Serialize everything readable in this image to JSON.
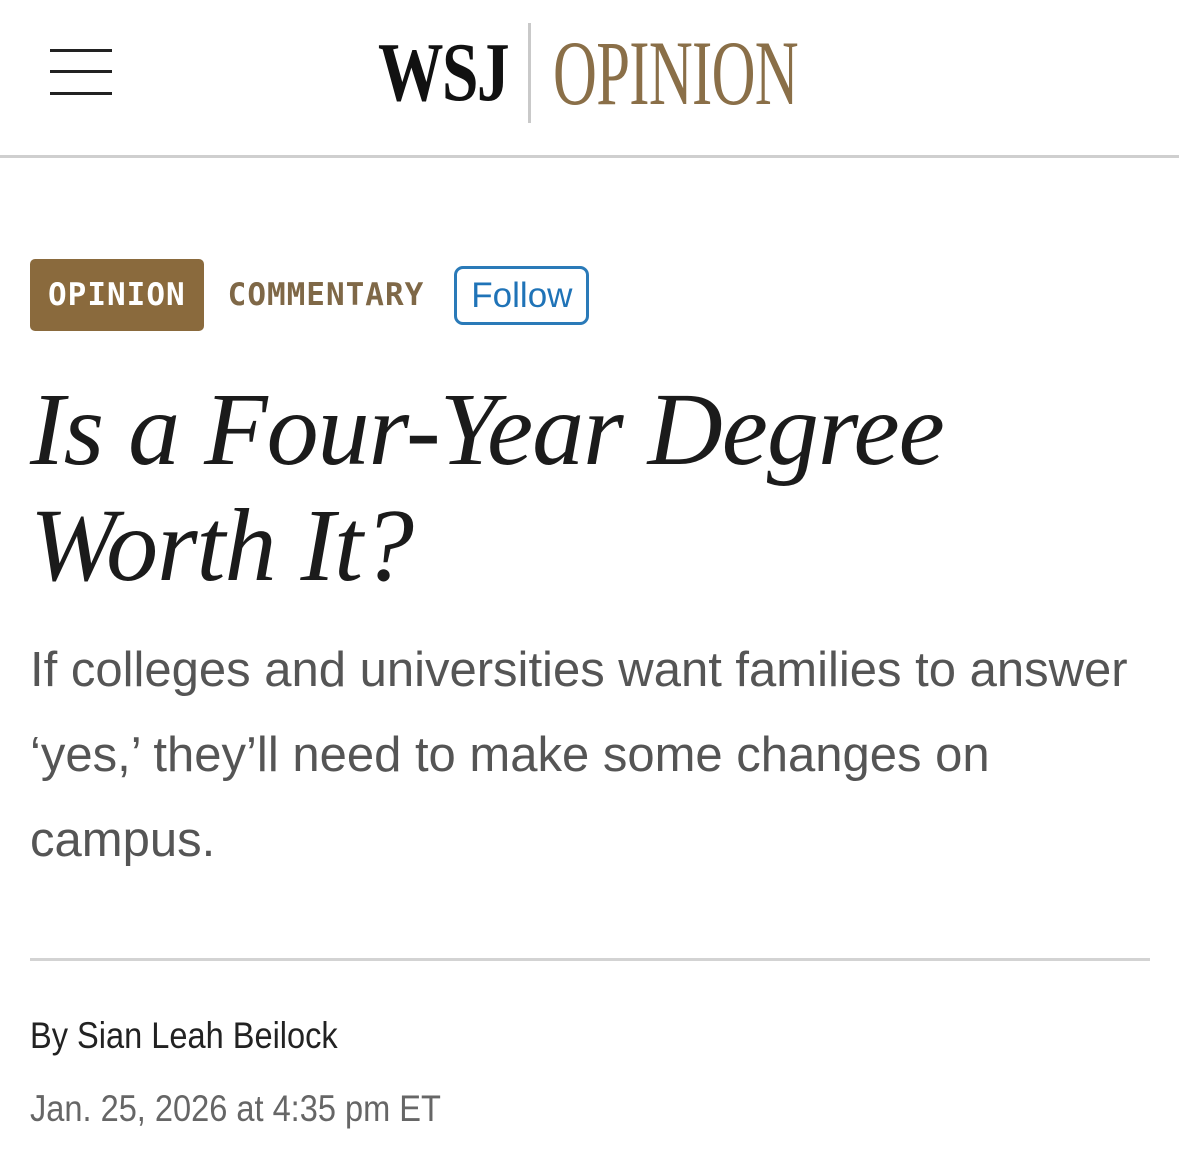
{
  "header": {
    "menu_icon": "hamburger-menu-icon",
    "logo_wsj": "WSJ",
    "logo_section": "OPINION"
  },
  "article": {
    "section_tag": "OPINION",
    "category": "COMMENTARY",
    "follow_label": "Follow",
    "headline": "Is a Four-Year Degree Worth It?",
    "dek": "If colleges and universities want families to answer ‘yes,’ they’ll need to make some changes on campus.",
    "byline_prefix": "By ",
    "author": "Sian Leah Beilock",
    "date": "Jan. 25, 2026 at 4:35 pm ET"
  },
  "colors": {
    "opinion_brand": "#8a6a3d",
    "follow_blue": "#1f73b7"
  }
}
